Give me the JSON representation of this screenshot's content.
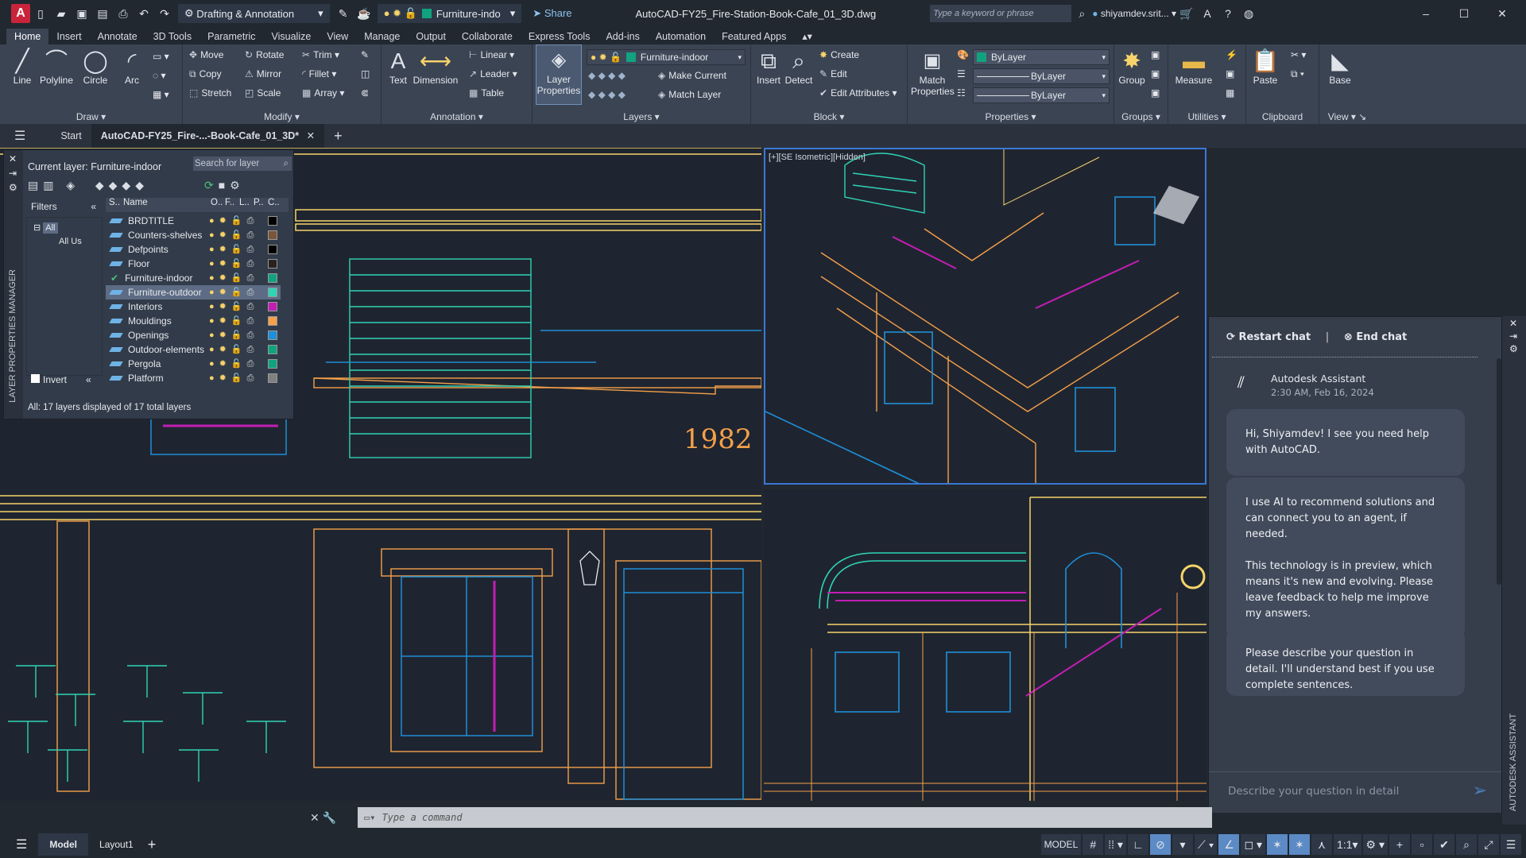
{
  "titlebar": {
    "app_logo": "A",
    "workspace": "Drafting & Annotation",
    "layer_quick": "Furniture-indo",
    "share": "Share",
    "doc_title": "AutoCAD-FY25_Fire-Station-Book-Cafe_01_3D.dwg",
    "search_placeholder": "Type a keyword or phrase",
    "user": "shiyamdev.srit..."
  },
  "ribbon_tabs": [
    "Home",
    "Insert",
    "Annotate",
    "3D Tools",
    "Parametric",
    "Visualize",
    "View",
    "Manage",
    "Output",
    "Collaborate",
    "Express Tools",
    "Add-ins",
    "Automation",
    "Featured Apps"
  ],
  "ribbon": {
    "draw": {
      "label": "Draw",
      "line": "Line",
      "polyline": "Polyline",
      "circle": "Circle",
      "arc": "Arc"
    },
    "modify": {
      "label": "Modify",
      "move": "Move",
      "rotate": "Rotate",
      "trim": "Trim",
      "copy": "Copy",
      "mirror": "Mirror",
      "fillet": "Fillet",
      "stretch": "Stretch",
      "scale": "Scale",
      "array": "Array"
    },
    "annotation": {
      "label": "Annotation",
      "text": "Text",
      "dimension": "Dimension",
      "linear": "Linear",
      "leader": "Leader",
      "table": "Table"
    },
    "layers": {
      "label": "Layers",
      "layer_properties": "Layer Properties",
      "current": "Furniture-indoor",
      "make_current": "Make Current",
      "match_layer": "Match Layer"
    },
    "block": {
      "label": "Block",
      "insert": "Insert",
      "detect": "Detect",
      "create": "Create",
      "edit": "Edit",
      "edit_attributes": "Edit Attributes"
    },
    "properties": {
      "label": "Properties",
      "match": "Match Properties",
      "color": "ByLayer",
      "linetype": "ByLayer",
      "lineweight": "ByLayer"
    },
    "groups": {
      "label": "Groups",
      "group": "Group"
    },
    "utilities": {
      "label": "Utilities",
      "measure": "Measure"
    },
    "clipboard": {
      "label": "Clipboard",
      "paste": "Paste"
    },
    "view": {
      "label": "View",
      "base": "Base"
    }
  },
  "file_tabs": {
    "start": "Start",
    "active": "AutoCAD-FY25_Fire-...-Book-Cafe_01_3D*"
  },
  "viewport_label": "[+][SE Isometric][Hidden]",
  "drawing_text": "1982",
  "layer_manager": {
    "side_title": "LAYER PROPERTIES MANAGER",
    "current_layer": "Current layer: Furniture-indoor",
    "search_placeholder": "Search for layer",
    "filters": "Filters",
    "filter_all": "All",
    "filter_used": "All Us",
    "invert": "Invert",
    "columns": [
      "S..",
      "Name",
      "O..",
      "F..",
      "L..",
      "P..",
      "C.."
    ],
    "layers": [
      {
        "name": "BRDTITLE",
        "color": "#000000"
      },
      {
        "name": "Counters-shelves",
        "color": "#7b5538"
      },
      {
        "name": "Defpoints",
        "color": "#000000"
      },
      {
        "name": "Floor",
        "color": "#2a2220"
      },
      {
        "name": "Furniture-indoor",
        "color": "#11a37f",
        "current": true
      },
      {
        "name": "Furniture-outdoor",
        "color": "#2fd3b5",
        "selected": true
      },
      {
        "name": "Interiors",
        "color": "#c21eb4"
      },
      {
        "name": "Mouldings",
        "color": "#f5a04a"
      },
      {
        "name": "Openings",
        "color": "#1e8fd8"
      },
      {
        "name": "Outdoor-elements",
        "color": "#11a37f"
      },
      {
        "name": "Pergola",
        "color": "#11a37f"
      },
      {
        "name": "Platform",
        "color": "#808080"
      }
    ],
    "summary": "All: 17 layers displayed of 17 total layers"
  },
  "chat": {
    "restart": "Restart chat",
    "end": "End chat",
    "assistant_name": "Autodesk Assistant",
    "timestamp": "2:30 AM, Feb 16, 2024",
    "messages": [
      "Hi, Shiyamdev! I see you need help with AutoCAD.",
      "I use AI to recommend solutions and can connect you to an agent, if needed.\n\nThis technology is in preview, which means it's new and evolving. Please leave feedback to help me improve my answers.",
      "Please describe your question in detail. I'll understand best if you use complete sentences."
    ],
    "input_placeholder": "Describe your question in detail",
    "side_title": "AUTODESK ASSISTANT"
  },
  "command": {
    "placeholder": "Type  a  command"
  },
  "status": {
    "model_tab": "Model",
    "layout_tab": "Layout1",
    "model": "MODEL",
    "scale": "1:1"
  }
}
